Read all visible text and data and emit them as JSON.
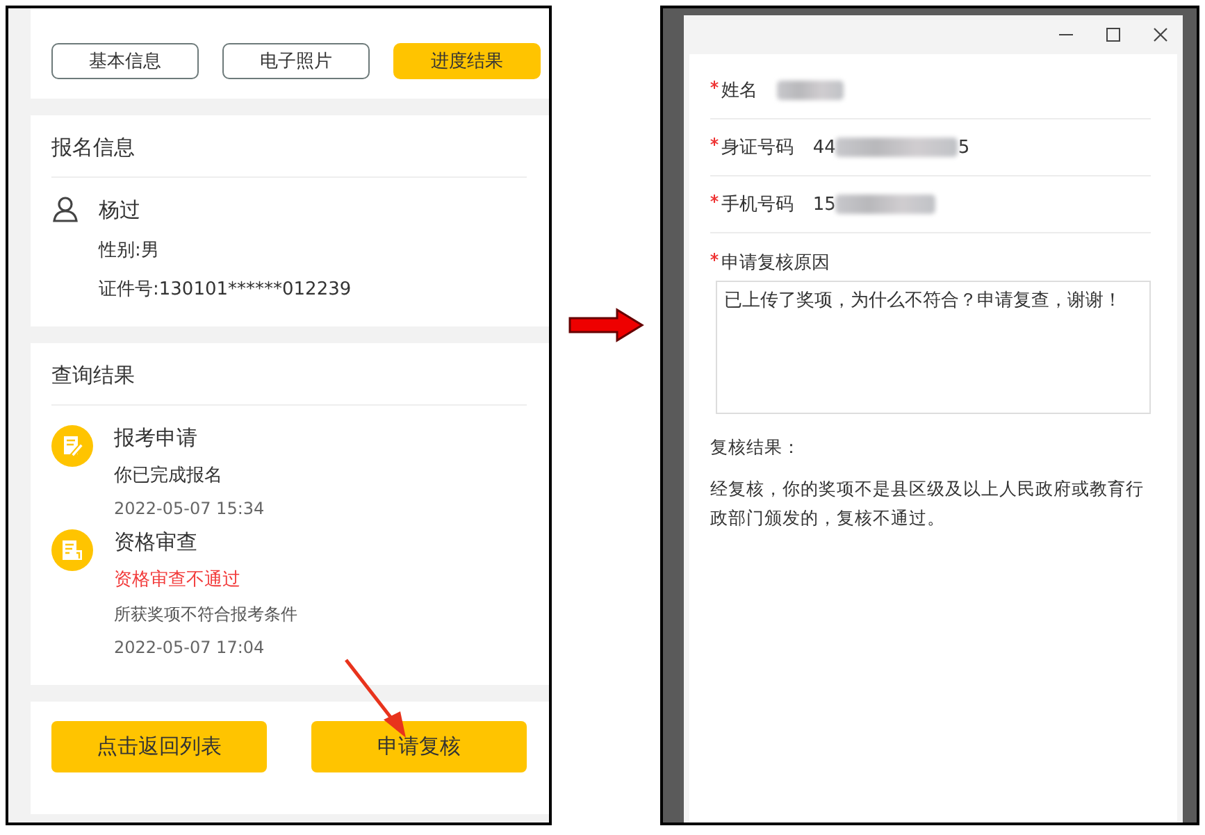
{
  "phone_screen": {
    "tabs": [
      {
        "label": "基本信息",
        "selected": false
      },
      {
        "label": "电子照片",
        "selected": false
      },
      {
        "label": "进度结果",
        "selected": true
      }
    ],
    "registration": {
      "heading": "报名信息",
      "name": "杨过",
      "gender": "性别:男",
      "id_number": "证件号:130101******012239"
    },
    "results": {
      "heading": "查询结果",
      "steps": [
        {
          "kind": "apply",
          "title": "报考申请",
          "status": "你已完成报名",
          "failed": false,
          "time": "2022-05-07 15:34"
        },
        {
          "kind": "review",
          "title": "资格审查",
          "status": "资格审查不通过",
          "failed": true,
          "note": "所获奖项不符合报考条件",
          "time": "2022-05-07 17:04"
        }
      ]
    },
    "buttons": [
      "点击返回列表",
      "申请复核"
    ]
  },
  "review_dialog": {
    "fields": [
      {
        "label": "姓名",
        "required": true
      },
      {
        "label": "身证号码",
        "required": true,
        "value_start": "44",
        "value_end": "5"
      },
      {
        "label": "手机号码",
        "required": true,
        "value_start": "15"
      }
    ],
    "reason": {
      "label": "申请复核原因",
      "required": true,
      "value": "已上传了奖项，为什么不符合？申请复查，谢谢！"
    },
    "result": {
      "heading": "复核结果：",
      "text": "经复核，你的奖项不是县区级及以上人民政府或教育行政部门颁发的，复核不通过。"
    }
  }
}
